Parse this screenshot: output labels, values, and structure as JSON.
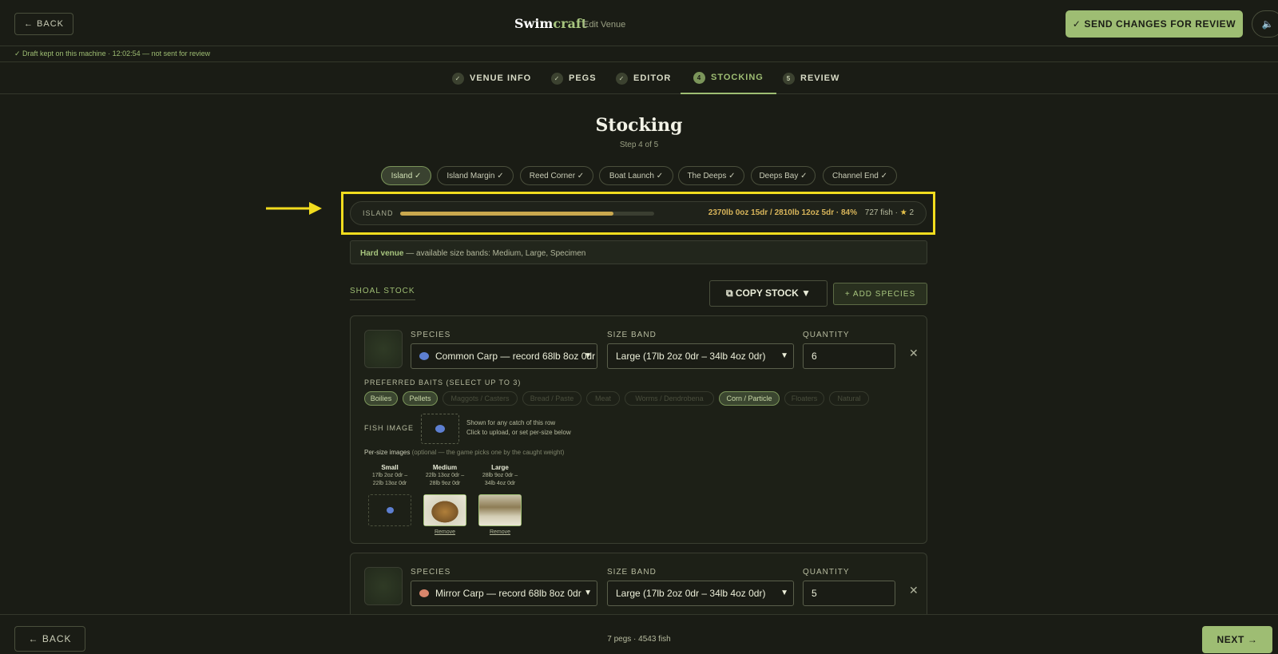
{
  "header": {
    "back_label": "← BACK",
    "brand_main": "Swim",
    "brand_accent": "craft",
    "subtitle": "Edit Venue",
    "send_label": "✓ SEND CHANGES FOR REVIEW",
    "sound_icon": "🔈"
  },
  "draft_status": "✓ Draft kept on this machine · 12:02:54 — not sent for review",
  "tabs": [
    {
      "badge": "✓",
      "label": "VENUE INFO"
    },
    {
      "badge": "✓",
      "label": "PEGS"
    },
    {
      "badge": "✓",
      "label": "EDITOR"
    },
    {
      "badge": "4",
      "label": "STOCKING"
    },
    {
      "badge": "5",
      "label": "REVIEW"
    }
  ],
  "page": {
    "title": "Stocking",
    "step": "Step 4 of 5"
  },
  "pegs": [
    "Island ✓",
    "Island Margin ✓",
    "Reed Corner ✓",
    "Boat Launch ✓",
    "The Deeps ✓",
    "Deeps Bay ✓",
    "Channel End ✓"
  ],
  "summary": {
    "label": "ISLAND",
    "progress": 0.84,
    "weight": "2370lb 0oz 15dr / 2810lb 12oz 5dr · 84%",
    "fish": "727 fish ·",
    "star": "★",
    "stars": "2"
  },
  "note": {
    "bold": "Hard venue",
    "text": " — available size bands: Medium, Large, Specimen"
  },
  "shoal": {
    "label": "SHOAL STOCK",
    "copy_label": "⧉ COPY STOCK ▼",
    "add_label": "+ ADD SPECIES"
  },
  "rows": [
    {
      "species_label": "SPECIES",
      "species": "Common Carp — record 68lb 8oz 0dr",
      "size_label": "SIZE BAND",
      "size": "Large (17lb 2oz 0dr – 34lb 4oz 0dr)",
      "qty_label": "QUANTITY",
      "qty": "6",
      "close": "✕"
    },
    {
      "species_label": "SPECIES",
      "species": "Mirror Carp — record 68lb 8oz 0dr",
      "size_label": "SIZE BAND",
      "size": "Large (17lb 2oz 0dr – 34lb 4oz 0dr)",
      "qty_label": "QUANTITY",
      "qty": "5",
      "close": "✕"
    }
  ],
  "baits": {
    "label": "PREFERRED BAITS (SELECT UP TO 3)",
    "items": [
      "Boilies",
      "Pellets",
      "Maggots / Casters",
      "Bread / Paste",
      "Meat",
      "Worms / Dendrobena",
      "Corn / Particle",
      "Floaters",
      "Natural"
    ]
  },
  "fish_image": {
    "label": "FISH IMAGE",
    "line1": "Shown for any catch of this row",
    "line2": "Click to upload, or set per-size below"
  },
  "per_size": {
    "label": "Per-size images",
    "optional": " (optional — the game picks one by the caught weight)",
    "sizes": [
      {
        "name": "Small",
        "r1": "17lb 2oz 0dr –",
        "r2": "22lb 13oz 0dr"
      },
      {
        "name": "Medium",
        "r1": "22lb 13oz 0dr –",
        "r2": "28lb 9oz 0dr",
        "remove": "Remove"
      },
      {
        "name": "Large",
        "r1": "28lb 9oz 0dr –",
        "r2": "34lb 4oz 0dr",
        "remove": "Remove"
      }
    ]
  },
  "footer": {
    "back_label": "← BACK",
    "stats": "7 pegs · 4543 fish",
    "next_label": "NEXT →"
  }
}
